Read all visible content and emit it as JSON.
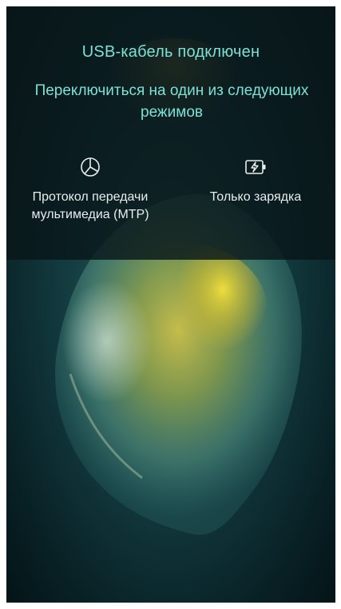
{
  "dialog": {
    "title": "USB-кабель подключен",
    "subtitle": "Переключиться на один из следующих режимов",
    "modes": [
      {
        "label": "Протокол передачи мультимедиа (MTP)",
        "icon": "pie-chart-icon"
      },
      {
        "label": "Только зарядка",
        "icon": "battery-charging-icon"
      }
    ]
  },
  "colors": {
    "accent": "#7ce1d6",
    "label": "#e9eeee",
    "overlay": "rgba(8, 22, 24, 0.82)",
    "background": "#133c41"
  }
}
